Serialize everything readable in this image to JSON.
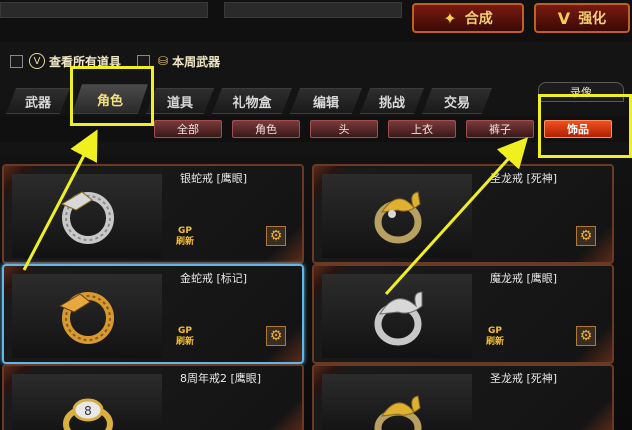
{
  "header": {
    "synthesize_label": "合成",
    "synthesize_icon": "sparkle-wand-icon",
    "enhance_label": "强化",
    "enhance_icon": "v-emblem-icon"
  },
  "filters": {
    "all_items_label": "查看所有道具",
    "all_items_icon": "v-circle-icon",
    "weekly_label": "本周武器",
    "weekly_icon": "bag-icon"
  },
  "tabs": [
    {
      "label": "武器",
      "active": false
    },
    {
      "label": "角色",
      "active": true
    },
    {
      "label": "道具",
      "active": false
    },
    {
      "label": "礼物盒",
      "active": false
    },
    {
      "label": "编辑",
      "active": false
    },
    {
      "label": "挑战",
      "active": false
    },
    {
      "label": "交易",
      "active": false
    }
  ],
  "record_tab": "录像",
  "subfilters": [
    {
      "label": "全部",
      "active": false
    },
    {
      "label": "角色",
      "active": false
    },
    {
      "label": "头",
      "active": false
    },
    {
      "label": "上衣",
      "active": false
    },
    {
      "label": "裤子",
      "active": false
    },
    {
      "label": "饰品",
      "active": true
    }
  ],
  "items": [
    {
      "name": "银蛇戒 [鹰眼]",
      "badge": "GP\n刷新",
      "selected": false,
      "ring": "silver-snake"
    },
    {
      "name": "圣龙戒 [死神]",
      "badge": "",
      "selected": false,
      "ring": "gold-dragon"
    },
    {
      "name": "金蛇戒 [标记]",
      "badge": "GP\n刷新",
      "selected": true,
      "ring": "gold-snake"
    },
    {
      "name": "魔龙戒 [鹰眼]",
      "badge": "GP\n刷新",
      "selected": false,
      "ring": "silver-dragon"
    },
    {
      "name": "8周年戒2 [鹰眼]",
      "badge": "",
      "selected": false,
      "ring": "gold-8"
    },
    {
      "name": "圣龙戒 [死神]",
      "badge": "",
      "selected": false,
      "ring": "gold-dragon"
    }
  ],
  "colors": {
    "highlight": "#f0f020",
    "selected_border": "#5fb8e8",
    "active_subfilter": "#f05020"
  }
}
